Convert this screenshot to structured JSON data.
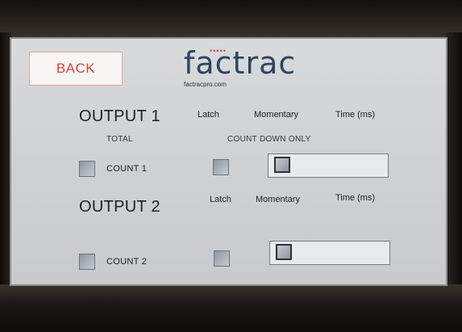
{
  "header": {
    "back_label": "BACK",
    "logo_text": "factrac",
    "logo_url": "factracpro.com",
    "logo_dots": "•••••"
  },
  "output1": {
    "title": "OUTPUT 1",
    "col_latch": "Latch",
    "col_momentary": "Momentary",
    "col_time": "Time (ms)",
    "total_label": "TOTAL",
    "count_down_label": "COUNT DOWN ONLY",
    "count_label": "COUNT 1"
  },
  "output2": {
    "title": "OUTPUT 2",
    "col_latch": "Latch",
    "col_momentary": "Momentary",
    "col_time": "Time (ms)",
    "count_label": "COUNT 2"
  },
  "colors": {
    "back_text": "#d0473d",
    "logo": "#2d4563",
    "screen_bg": "#d2d4d6"
  }
}
